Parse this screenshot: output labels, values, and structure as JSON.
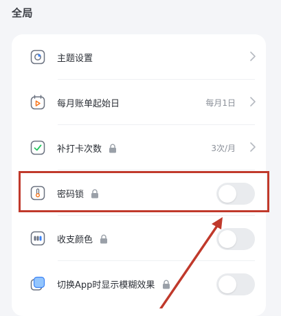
{
  "section": {
    "title": "全局"
  },
  "settings": {
    "items": [
      {
        "label": "主题设置",
        "value": "",
        "icon": "theme-palette-icon",
        "locked": false,
        "control": "chevron"
      },
      {
        "label": "每月账单起始日",
        "value": "每月1日",
        "icon": "calendar-icon",
        "locked": false,
        "control": "chevron"
      },
      {
        "label": "补打卡次数",
        "value": "3次/月",
        "icon": "checkmark-icon",
        "locked": true,
        "control": "chevron"
      },
      {
        "label": "密码锁",
        "value": "",
        "icon": "thermometer-lock-icon",
        "locked": true,
        "control": "toggle",
        "toggle_on": false
      },
      {
        "label": "收支颜色",
        "value": "",
        "icon": "color-dots-icon",
        "locked": true,
        "control": "toggle",
        "toggle_on": false
      },
      {
        "label": "切换App时显示模糊效果",
        "value": "",
        "icon": "blur-square-icon",
        "locked": true,
        "control": "toggle",
        "toggle_on": false
      }
    ]
  },
  "annotation": {
    "highlight_color": "#c0392b",
    "target": "密码锁"
  },
  "colors": {
    "background": "#f4f5f8",
    "card": "#ffffff",
    "toggle_off": "#e9ebee",
    "icon_stroke": "#6b7280",
    "icon_blue": "#3b82f6",
    "icon_orange": "#f97316",
    "icon_green": "#22c55e"
  }
}
